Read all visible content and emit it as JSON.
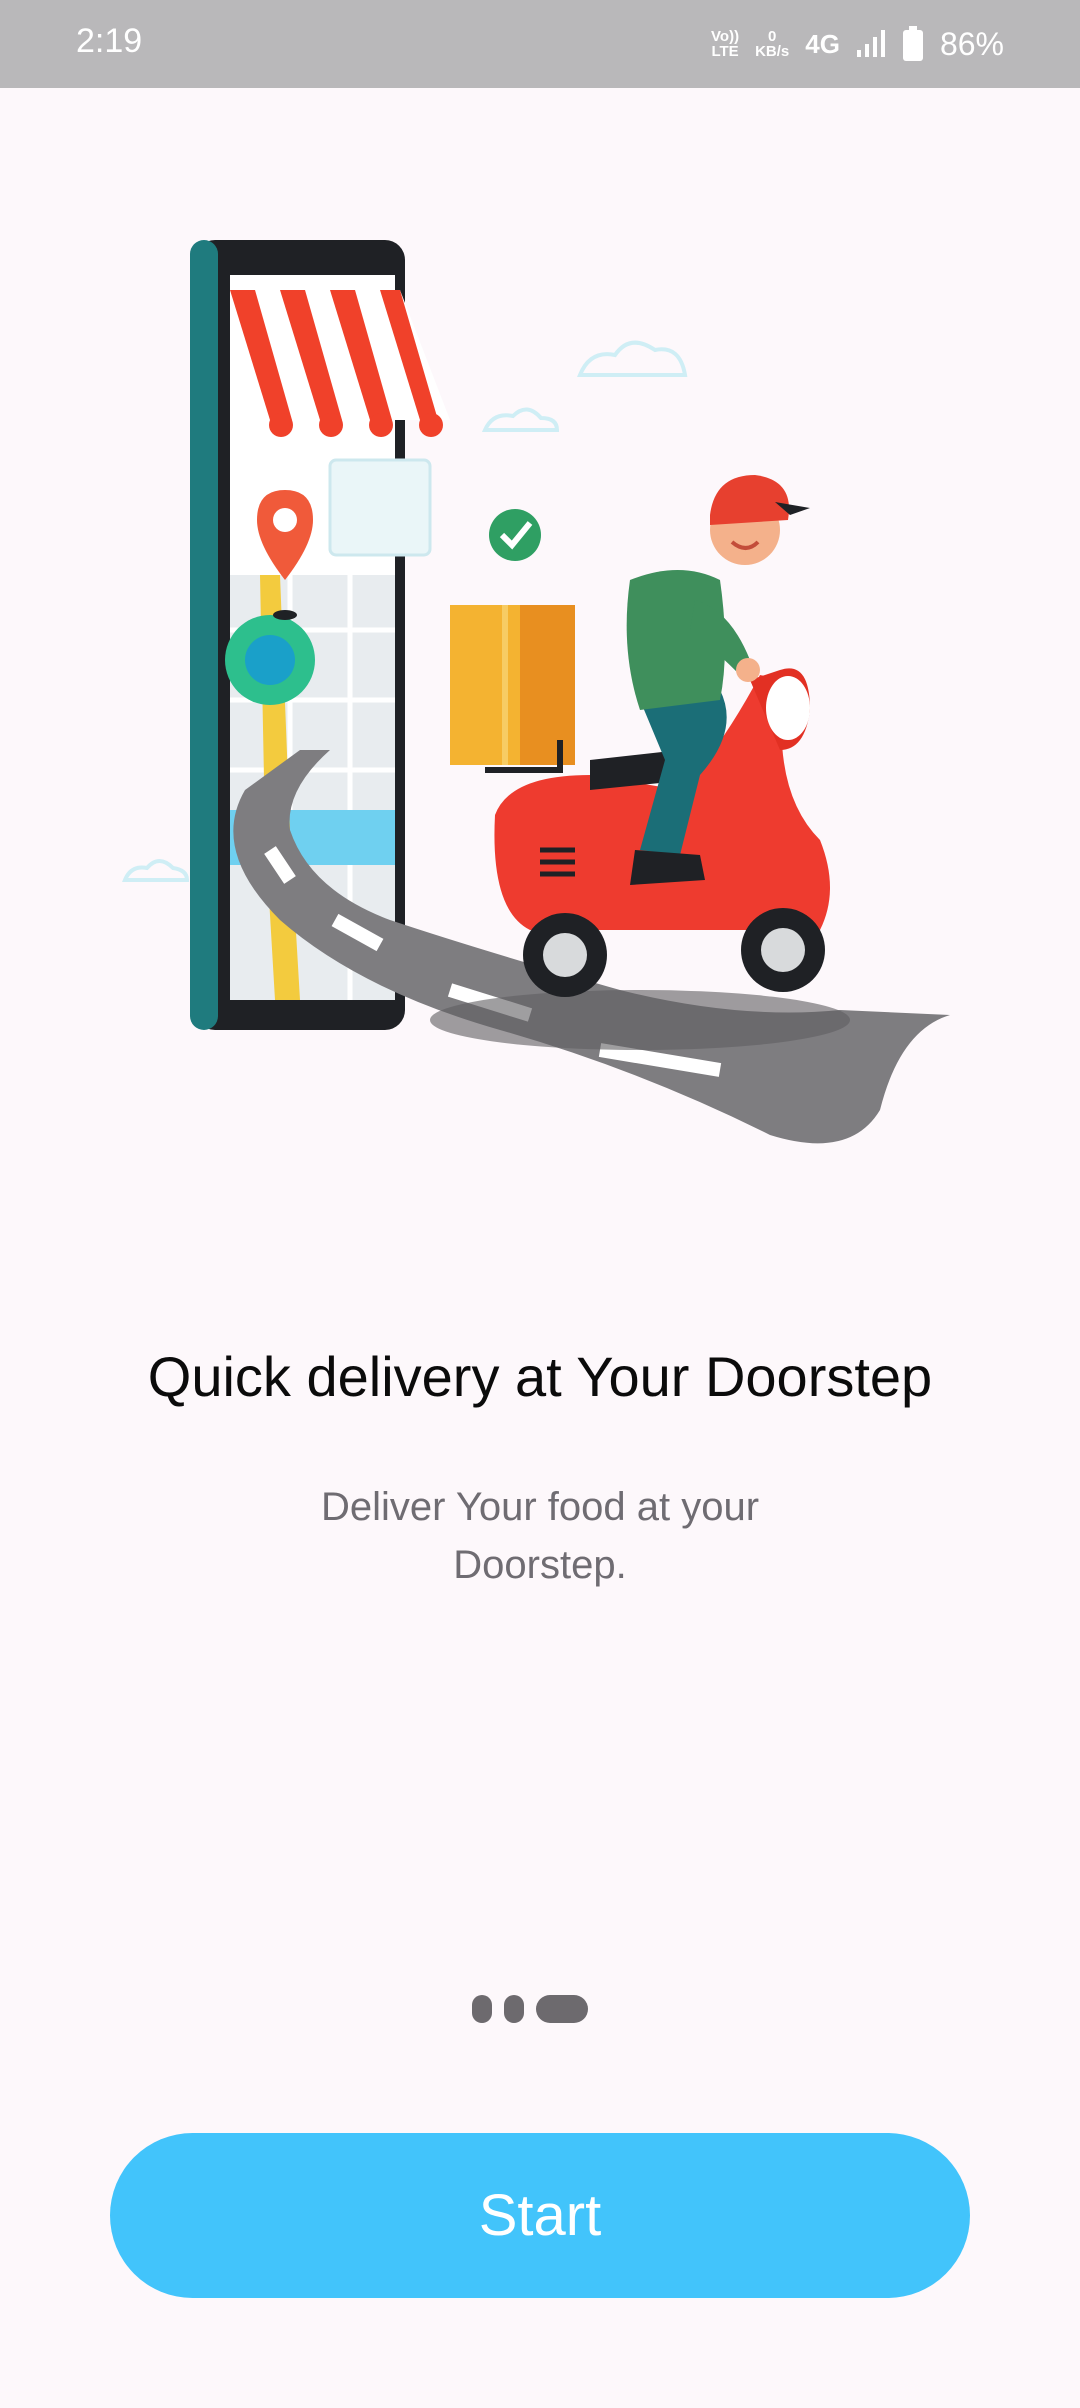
{
  "status_bar": {
    "time": "2:19",
    "volte_top": "Vo))",
    "volte_bottom": "LTE",
    "speed_value": "0",
    "speed_unit": "KB/s",
    "network": "4G",
    "battery_percent": "86%"
  },
  "onboarding": {
    "title": "Quick delivery at Your Doorstep",
    "subtitle": "Deliver Your food at your Doorstep.",
    "page_count": 3,
    "active_page": 3
  },
  "actions": {
    "start_label": "Start"
  },
  "colors": {
    "background": "#fdf8fb",
    "status_bar": "#b9b8ba",
    "button": "#42c4fb",
    "title": "#0b0b0b",
    "subtitle": "#6f6c72",
    "pager_dot": "#6d6a6e"
  },
  "icons": {
    "signal": "signal-bars-icon",
    "battery": "battery-icon",
    "illustration": "scooter-delivery-illustration"
  }
}
